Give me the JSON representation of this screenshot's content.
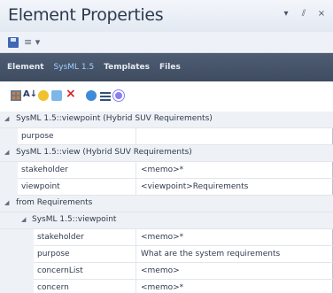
{
  "window": {
    "title": "Element Properties",
    "controls": [
      "▾",
      "⫽",
      "×"
    ]
  },
  "quickbar": {
    "menu_glyph": "≡ ▾"
  },
  "tabs": [
    {
      "label": "Element",
      "active": false
    },
    {
      "label": "SysML 1.5",
      "active": true
    },
    {
      "label": "Templates",
      "active": false
    },
    {
      "label": "Files",
      "active": false
    }
  ],
  "toolbar": {
    "sort_glyph": "A↓"
  },
  "grid": {
    "sections": [
      {
        "label": "SysML 1.5::viewpoint (Hybrid SUV Requirements)"
      },
      {
        "label": "SysML 1.5::view (Hybrid SUV Requirements)"
      },
      {
        "label": "from Requirements"
      },
      {
        "label": "SysML 1.5::viewpoint"
      }
    ],
    "rows_a": [
      {
        "name": "purpose",
        "value": ""
      }
    ],
    "rows_b": [
      {
        "name": "stakeholder",
        "value": "<memo>*"
      },
      {
        "name": "viewpoint",
        "value": "<viewpoint>Requirements"
      }
    ],
    "rows_c": [
      {
        "name": "stakeholder",
        "value": "<memo>*"
      },
      {
        "name": "purpose",
        "value": "What are the system requirements"
      },
      {
        "name": "concernList",
        "value": "<memo>"
      },
      {
        "name": "concern",
        "value": "<memo>*"
      }
    ],
    "caret": "◢"
  }
}
